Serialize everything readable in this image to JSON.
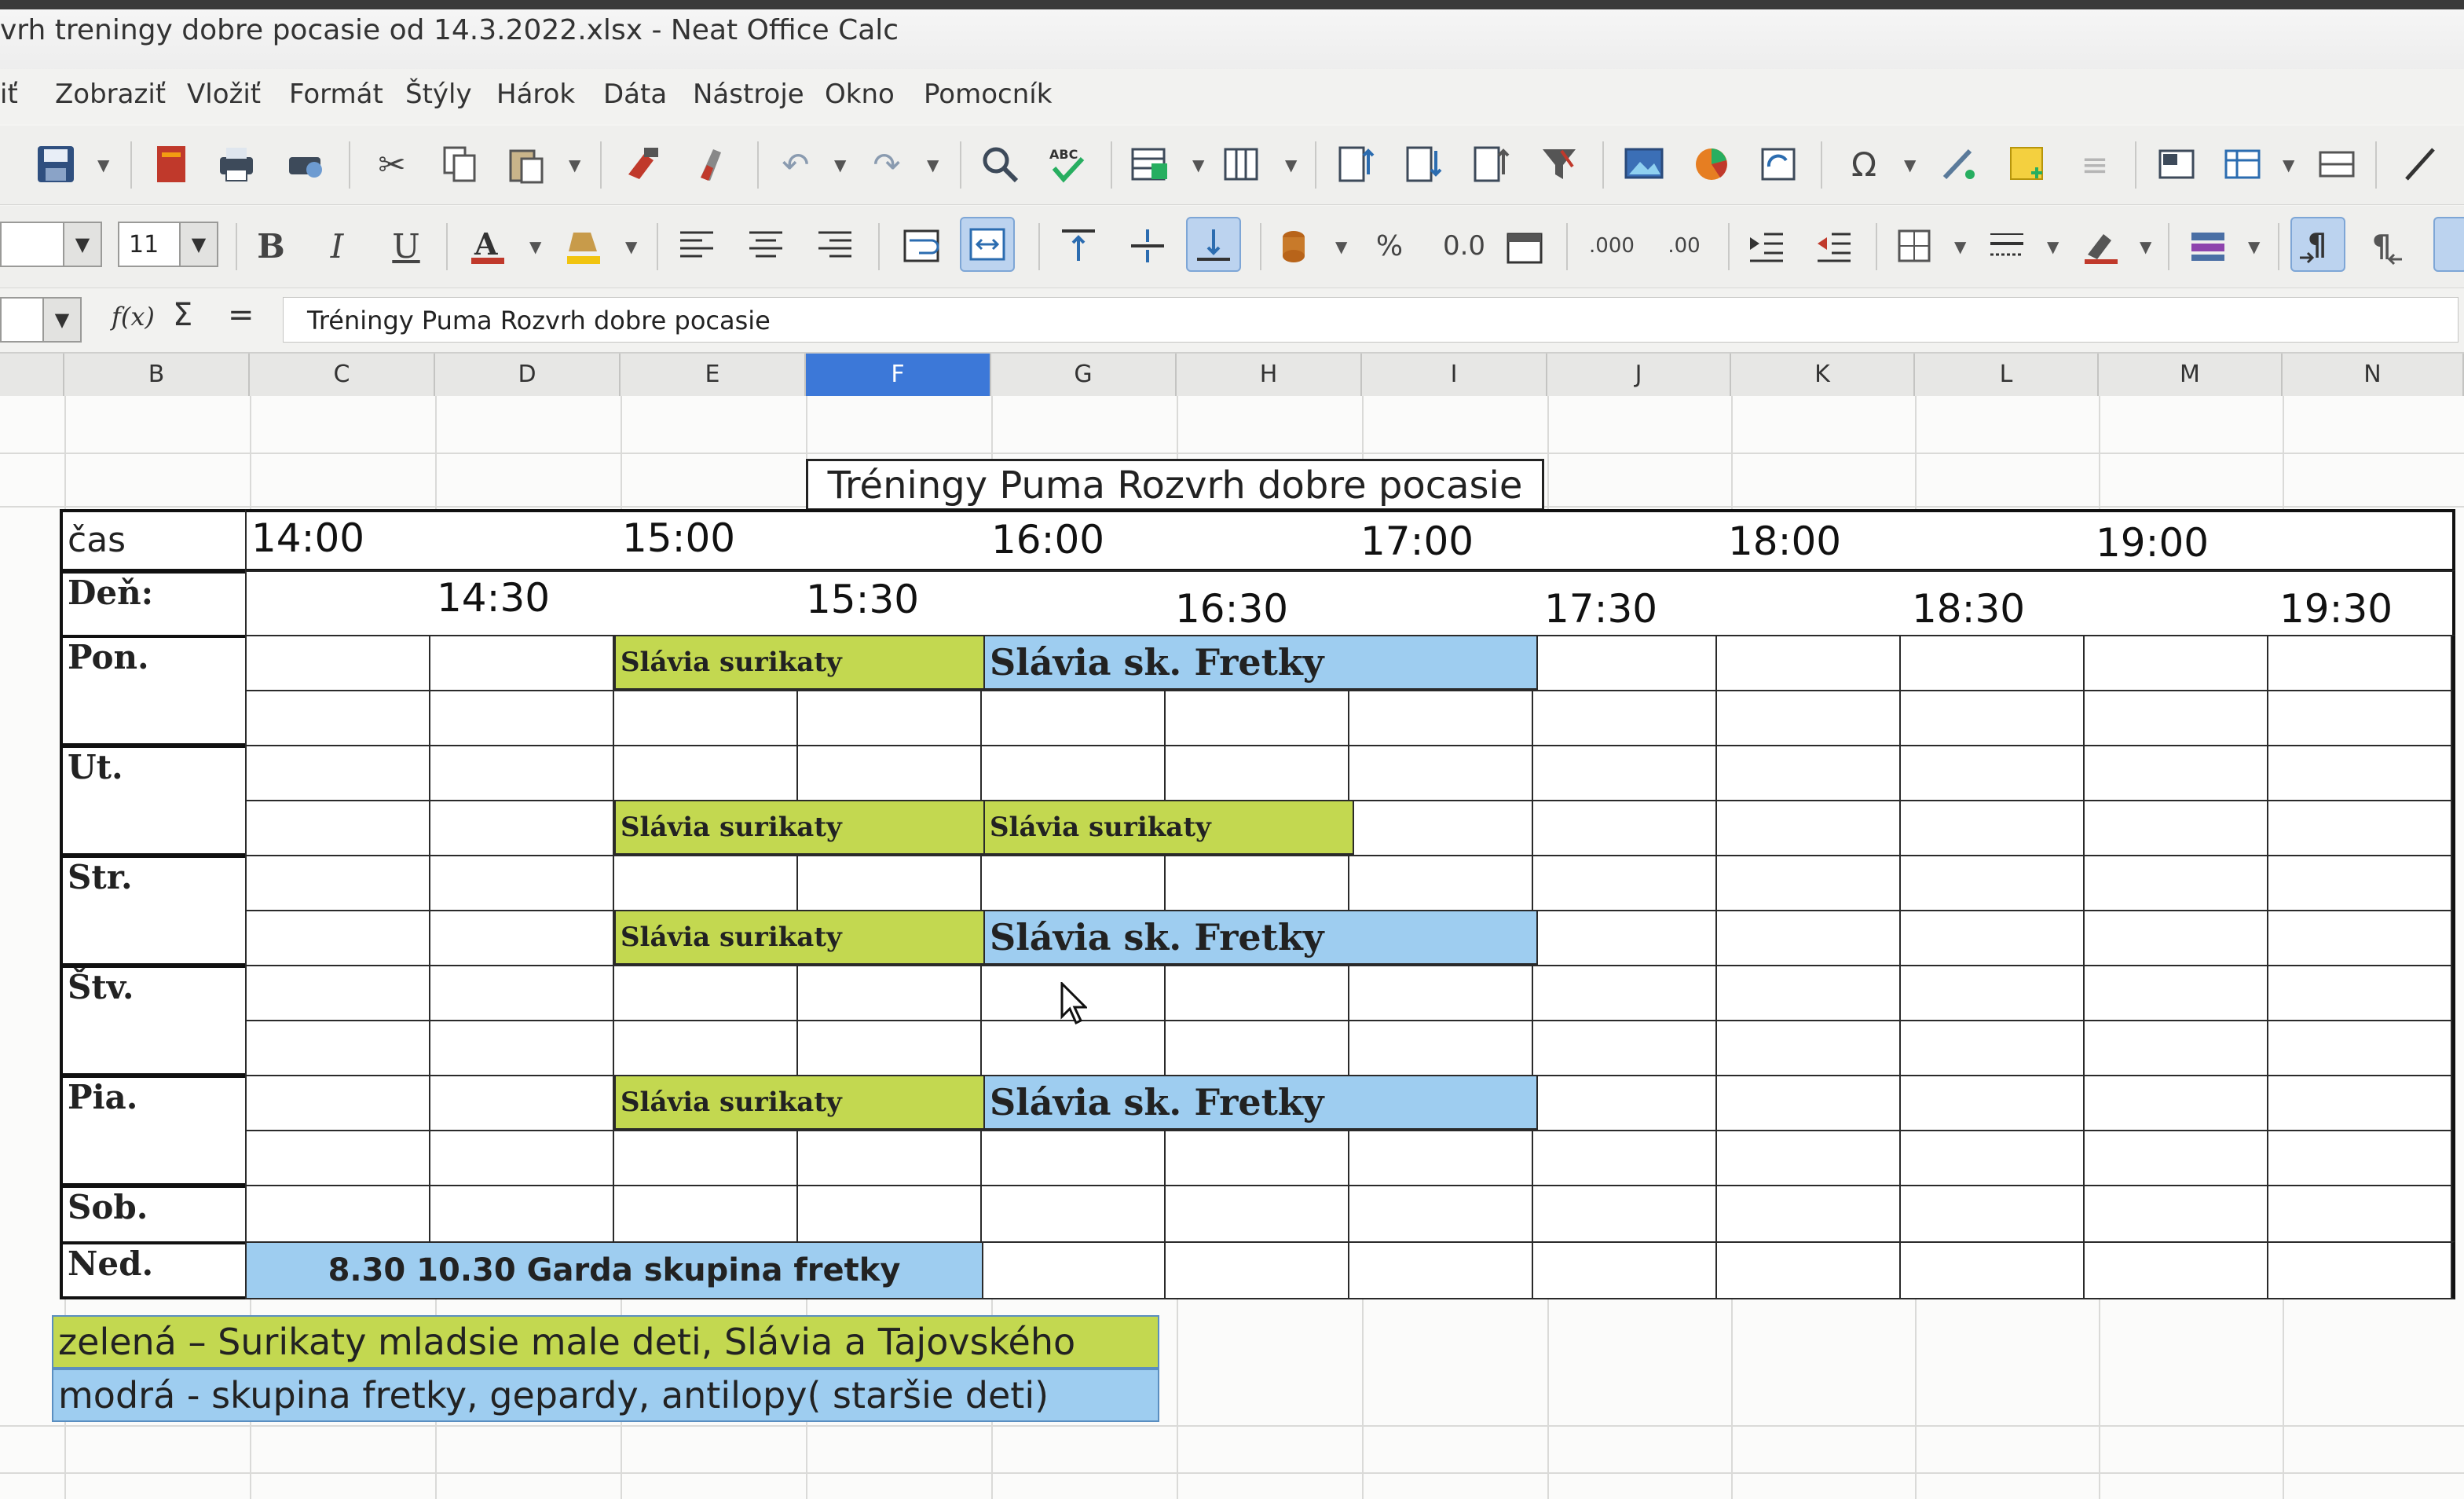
{
  "window": {
    "title": "vrh treningy dobre pocasie od 14.3.2022.xlsx - Neat Office Calc"
  },
  "menubar": {
    "items": [
      {
        "label": "iť"
      },
      {
        "label": "Zobraziť"
      },
      {
        "label": "Vložiť"
      },
      {
        "label": "Formát"
      },
      {
        "label": "Štýly"
      },
      {
        "label": "Hárok"
      },
      {
        "label": "Dáta"
      },
      {
        "label": "Nástroje"
      },
      {
        "label": "Okno"
      },
      {
        "label": "Pomocník"
      }
    ]
  },
  "toolbar2": {
    "font_size": "11",
    "bold": "B",
    "italic": "I",
    "underline": "U",
    "percent": "%",
    "number": "0.0",
    "add_decimal": ".000",
    "del_decimal": ".00"
  },
  "formulabar": {
    "fx": "f(x)",
    "sum": "Σ",
    "equals": "=",
    "content": "Tréningy Puma Rozvrh dobre pocasie"
  },
  "columns": [
    "B",
    "C",
    "D",
    "E",
    "F",
    "G",
    "H",
    "I",
    "J",
    "K",
    "L",
    "M",
    "N"
  ],
  "selected_column": "F",
  "sheet": {
    "heading": "Tréningy Puma Rozvrh dobre pocasie",
    "row_cas": "čas",
    "row_den": "Deň:",
    "times_top": [
      "14:00",
      "15:00",
      "16:00",
      "17:00",
      "18:00",
      "19:00"
    ],
    "times_bottom": [
      "14:30",
      "15:30",
      "16:30",
      "17:30",
      "18:30",
      "19:30"
    ],
    "days": [
      "Pon.",
      "Ut.",
      "Str.",
      "Štv.",
      "Pia.",
      "Sob.",
      "Ned."
    ],
    "blocks": {
      "surikaty": "Slávia surikaty",
      "fretky": "Slávia sk. Fretky",
      "nedela": "8.30 10.30 Garda skupina fretky"
    },
    "legend": {
      "green": "zelená – Surikaty mladsie male deti, Slávia a Tajovského",
      "blue": "modrá - skupina fretky, gepardy, antilopy( staršie deti)"
    }
  },
  "colors": {
    "green": "#c3d850",
    "blue": "#9ecdf0",
    "selected_header": "#3c78d8"
  }
}
